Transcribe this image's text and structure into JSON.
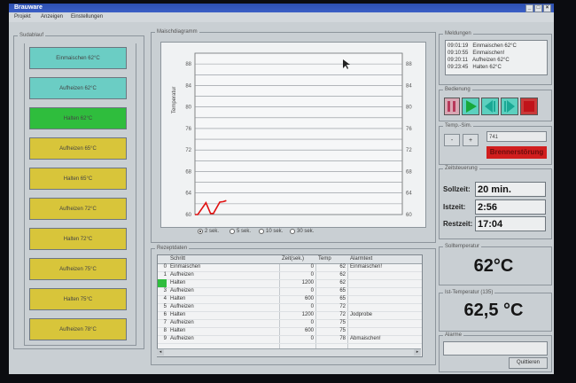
{
  "window": {
    "title": "Brauware",
    "buttons": {
      "minimize": "_",
      "maximize": "□",
      "close": "×"
    }
  },
  "menu": {
    "items": [
      "Projekt",
      "Anzeigen",
      "Einstellungen"
    ]
  },
  "sudablauf": {
    "label": "Sudablauf",
    "steps": [
      {
        "label": "Einmaischen 62°C",
        "color": "#6bcdc4"
      },
      {
        "label": "Aufheizen 62°C",
        "color": "#6bcdc4"
      },
      {
        "label": "Halten 62°C",
        "color": "#2fbd3d"
      },
      {
        "label": "Aufheizen 65°C",
        "color": "#d8c53a"
      },
      {
        "label": "Halten 65°C",
        "color": "#d8c53a"
      },
      {
        "label": "Aufheizen 72°C",
        "color": "#d8c53a"
      },
      {
        "label": "Halten 72°C",
        "color": "#d8c53a"
      },
      {
        "label": "Aufheizen 75°C",
        "color": "#d8c53a"
      },
      {
        "label": "Halten 75°C",
        "color": "#d8c53a"
      },
      {
        "label": "Aufheizen 78°C",
        "color": "#d8c53a"
      }
    ]
  },
  "maisch": {
    "label": "Maischdiagramm",
    "ylabel": "Temperatur",
    "options": [
      "2 sek.",
      "5 sek.",
      "10 sek.",
      "30 sek."
    ],
    "selected": "2 sek."
  },
  "chart_data": {
    "type": "line",
    "ylabel": "Temperatur",
    "ylim": [
      60,
      90
    ],
    "yticks": [
      60,
      62,
      64,
      66,
      68,
      70,
      72,
      74,
      76,
      78,
      80,
      82,
      84,
      86,
      88,
      90
    ],
    "grid": true,
    "series": [
      {
        "color": "#e01010",
        "x": [
          0,
          1,
          2,
          3,
          4,
          5,
          6,
          7
        ],
        "y": [
          60,
          60,
          62.2,
          60.2,
          60.2,
          62.3,
          62.4,
          62.6
        ]
      }
    ]
  },
  "rezept": {
    "label": "Rezeptdaten",
    "columns": [
      "Schritt",
      "Zeit(sek.)",
      "Temp",
      "Alarmtext"
    ],
    "rows": [
      {
        "idx": "0",
        "step": "Einmaischen",
        "time": "0",
        "temp": "62",
        "alarm": "Einmaischen!"
      },
      {
        "idx": "1",
        "step": "Aufheizen",
        "time": "0",
        "temp": "62",
        "alarm": ""
      },
      {
        "idx": "2",
        "step": "Halten",
        "time": "1200",
        "temp": "62",
        "alarm": ""
      },
      {
        "idx": "3",
        "step": "Aufheizen",
        "time": "0",
        "temp": "65",
        "alarm": ""
      },
      {
        "idx": "4",
        "step": "Halten",
        "time": "600",
        "temp": "65",
        "alarm": ""
      },
      {
        "idx": "5",
        "step": "Aufheizen",
        "time": "0",
        "temp": "72",
        "alarm": ""
      },
      {
        "idx": "6",
        "step": "Halten",
        "time": "1200",
        "temp": "72",
        "alarm": "Jodprobe"
      },
      {
        "idx": "7",
        "step": "Aufheizen",
        "time": "0",
        "temp": "75",
        "alarm": ""
      },
      {
        "idx": "8",
        "step": "Halten",
        "time": "600",
        "temp": "75",
        "alarm": ""
      },
      {
        "idx": "9",
        "step": "Aufheizen",
        "time": "0",
        "temp": "78",
        "alarm": "Abmaischen!"
      }
    ]
  },
  "meldungen": {
    "label": "Meldungen",
    "rows": [
      {
        "time": "09:01:19",
        "text": "Einmaischen 62°C"
      },
      {
        "time": "09:10:55",
        "text": "Einmaischen!"
      },
      {
        "time": "09:20:11",
        "text": "Aufheizen 62°C"
      },
      {
        "time": "09:23:45",
        "text": "Halten 62°C"
      }
    ]
  },
  "bedienung": {
    "label": "Bedienung"
  },
  "tempsim": {
    "label": "Temp.-Sim.",
    "minus": "-",
    "plus": "+",
    "value": "741",
    "warning": "Brennerstörung"
  },
  "zeit": {
    "label": "Zeitsteuerung",
    "soll_label": "Sollzeit:",
    "soll": "20 min.",
    "ist_label": "Istzeit:",
    "ist": "2:56",
    "rest_label": "Restzeit:",
    "rest": "17:04"
  },
  "solltemp": {
    "label": "Solltemperatur",
    "value": "62°C"
  },
  "isttemp": {
    "label": "Ist-Temperatur (135)",
    "value": "62,5 °C"
  },
  "alarme": {
    "label": "Alarme",
    "button": "Quittieren"
  }
}
